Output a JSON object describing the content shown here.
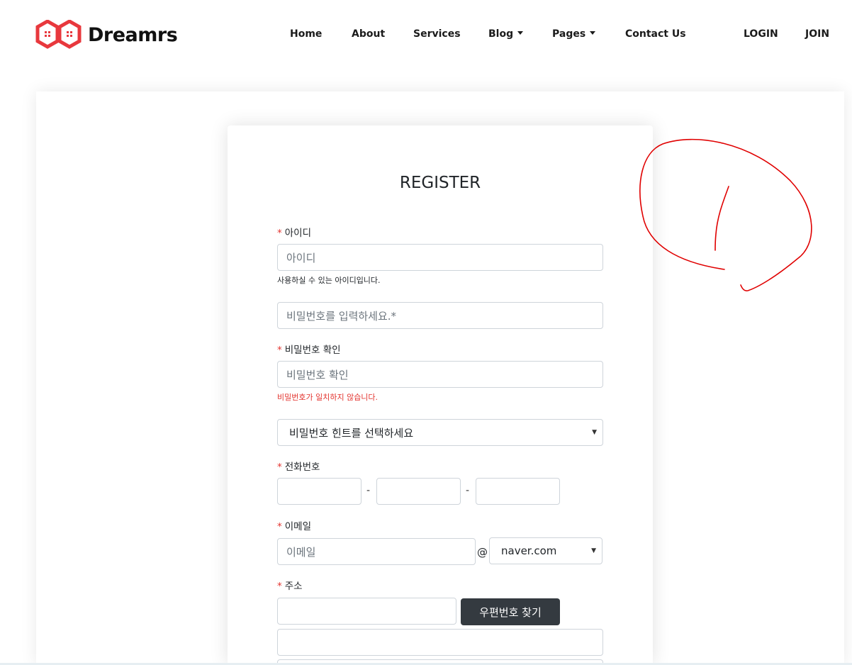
{
  "brand": {
    "name": "Dreamrs",
    "logo_color": "#e8383d"
  },
  "nav": {
    "home": "Home",
    "about": "About",
    "services": "Services",
    "blog": "Blog",
    "pages": "Pages",
    "contact": "Contact Us",
    "login": "LOGIN",
    "join": "JOIN"
  },
  "form": {
    "title": "REGISTER",
    "required_mark": "*",
    "id_label": "아이디",
    "id_placeholder": "아이디",
    "id_help": "사용하실 수 있는 아이디입니다.",
    "password_placeholder": "비밀번호를 입력하세요.*",
    "password_confirm_label": "비밀번호 확인",
    "password_confirm_placeholder": "비밀번호 확인",
    "password_error": "비밀번호가 일치하지 않습니다.",
    "hint_select": "비밀번호 힌트를 선택하세요",
    "phone_label": "전화번호",
    "phone_separator": "-",
    "email_label": "이메일",
    "email_placeholder": "이메일",
    "email_at": "@",
    "email_domain": "naver.com",
    "address_label": "주소",
    "zip_button": "우편번호 찾기"
  },
  "colors": {
    "accent_red": "#e3342f",
    "annotation_red": "#e00000",
    "button_dark": "#343a40"
  }
}
